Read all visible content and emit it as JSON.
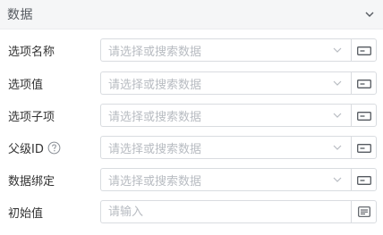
{
  "panel": {
    "title": "数据",
    "collapse_icon": "chevron-down-icon"
  },
  "fields": [
    {
      "label": "选项名称",
      "placeholder": "请选择或搜索数据",
      "button_icon": "variable-binding-icon"
    },
    {
      "label": "选项值",
      "placeholder": "请选择或搜索数据",
      "button_icon": "variable-binding-icon"
    },
    {
      "label": "选项子项",
      "placeholder": "请选择或搜索数据",
      "button_icon": "variable-binding-icon"
    },
    {
      "label": "父级ID",
      "placeholder": "请选择或搜索数据",
      "button_icon": "variable-binding-icon",
      "help_icon": "question-circle-icon"
    },
    {
      "label": "数据绑定",
      "placeholder": "请选择或搜索数据",
      "button_icon": "variable-binding-icon"
    },
    {
      "label": "初始值",
      "placeholder": "请输入",
      "value": "",
      "button_icon": "text-editor-icon"
    }
  ],
  "colors": {
    "header_bg": "#f5f6f7",
    "border": "#d9dce0",
    "placeholder": "#b8bcc2",
    "label": "#333333",
    "icon": "#555a60"
  }
}
